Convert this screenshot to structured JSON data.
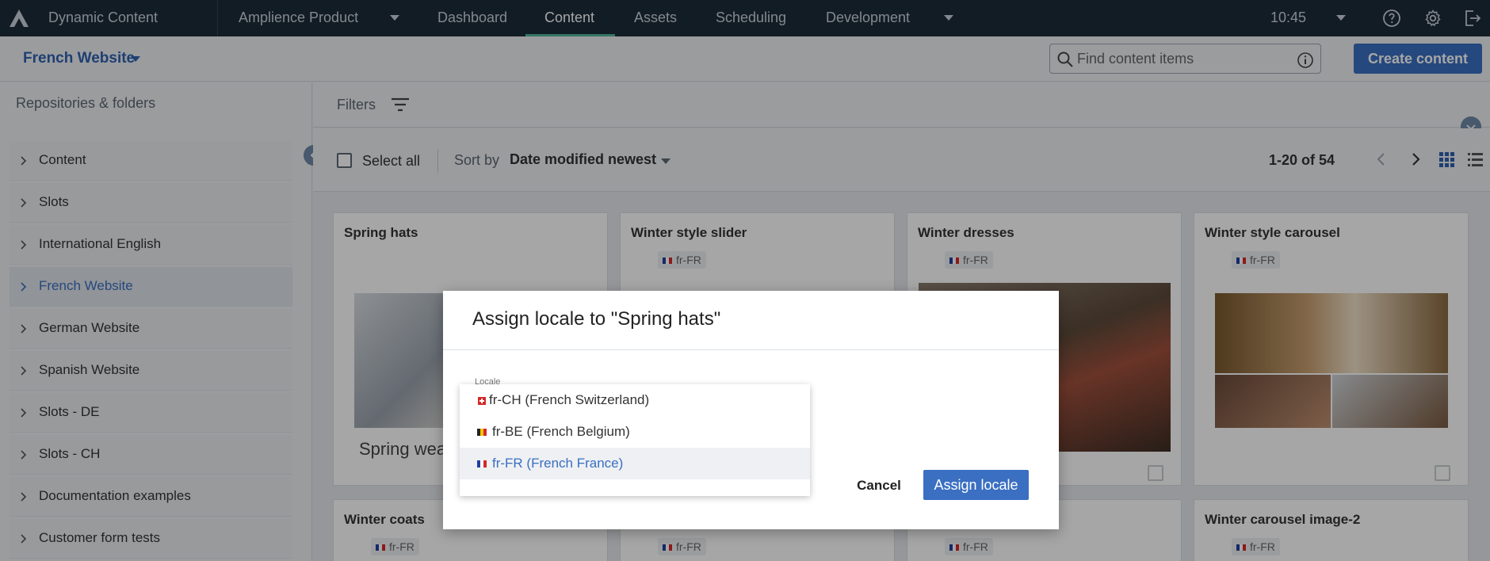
{
  "topnav": {
    "app_title": "Dynamic Content",
    "hub": "Amplience Product",
    "tabs": [
      "Dashboard",
      "Content",
      "Assets",
      "Scheduling",
      "Development"
    ],
    "active_tab": "Content",
    "time": "10:45"
  },
  "subheader": {
    "site": "French Website",
    "search_placeholder": "Find content items",
    "create_label": "Create content"
  },
  "sidebar": {
    "heading": "Repositories & folders",
    "items": [
      {
        "label": "Content"
      },
      {
        "label": "Slots"
      },
      {
        "label": "International English"
      },
      {
        "label": "French Website",
        "active": true
      },
      {
        "label": "German Website"
      },
      {
        "label": "Spanish Website"
      },
      {
        "label": "Slots - DE"
      },
      {
        "label": "Slots - CH"
      },
      {
        "label": "Documentation examples"
      },
      {
        "label": "Customer form tests"
      }
    ]
  },
  "filters": {
    "label": "Filters"
  },
  "toolbar": {
    "select_all": "Select all",
    "sort_by": "Sort by",
    "sort_value": "Date modified newest",
    "pager": "1-20 of 54"
  },
  "cards": [
    {
      "title": "Spring hats",
      "locale": "",
      "caption": "Spring wear"
    },
    {
      "title": "Winter style slider",
      "locale": "fr-FR"
    },
    {
      "title": "Winter dresses",
      "locale": "fr-FR"
    },
    {
      "title": "Winter style carousel",
      "locale": "fr-FR"
    },
    {
      "title": "Winter coats",
      "locale": "fr-FR"
    },
    {
      "title": "",
      "locale": "fr-FR"
    },
    {
      "title": "",
      "locale": "fr-FR"
    },
    {
      "title": "Winter carousel image-2",
      "locale": "fr-FR"
    }
  ],
  "modal": {
    "title": "Assign locale to \"Spring hats\"",
    "field_label": "Locale",
    "options": [
      {
        "label": "fr-CH (French Switzerland)",
        "flag": "swiss-flag-icon"
      },
      {
        "label": "fr-BE (French Belgium)",
        "flag": "belgian-flag-icon"
      },
      {
        "label": "fr-FR (French France)",
        "flag": "french-flag-icon",
        "selected": true
      }
    ],
    "cancel_label": "Cancel",
    "assign_label": "Assign locale"
  },
  "colors": {
    "nav_bg": "#1d2b3a",
    "accent": "#3a6fc2",
    "active_tab_bar": "#4fb69a"
  }
}
